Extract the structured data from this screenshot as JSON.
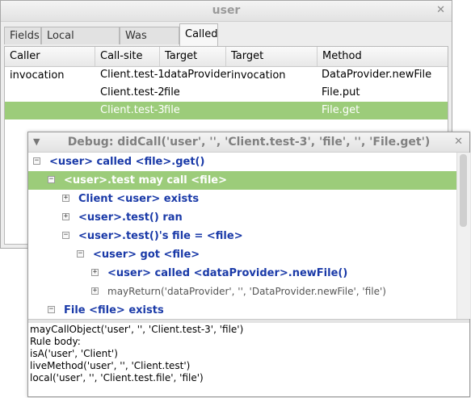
{
  "back_window": {
    "title": "user",
    "close_glyph": "✕",
    "tabs": [
      {
        "label": "Fields",
        "active": false
      },
      {
        "label": "Local variables",
        "active": false
      },
      {
        "label": "Was called",
        "active": false
      },
      {
        "label": "Called",
        "active": true
      }
    ],
    "columns": [
      "Caller invocation",
      "Call-site",
      "Target",
      "Target invocation",
      "Method"
    ],
    "rows": [
      {
        "caller_invocation": "",
        "call_site": "Client.test-1",
        "target": "dataProvider",
        "target_invocation": "",
        "method": "DataProvider.newFile",
        "selected": false
      },
      {
        "caller_invocation": "",
        "call_site": "Client.test-2",
        "target": "file",
        "target_invocation": "",
        "method": "File.put",
        "selected": false
      },
      {
        "caller_invocation": "",
        "call_site": "Client.test-3",
        "target": "file",
        "target_invocation": "",
        "method": "File.get",
        "selected": true
      }
    ],
    "selection_color": "#9ccc7a"
  },
  "debug_window": {
    "title": "Debug: didCall('user', '', 'Client.test-3', 'file', '', 'File.get')",
    "menu_glyph": "▼",
    "close_glyph": "✕",
    "tree": [
      {
        "label": "<user> called <file>.get()",
        "expander": "−",
        "selected": false,
        "plain": false
      },
      {
        "label": "<user>.test may call <file>",
        "expander": "−",
        "selected": true,
        "plain": false
      },
      {
        "label": "Client <user> exists",
        "expander": "+",
        "selected": false,
        "plain": false
      },
      {
        "label": "<user>.test() ran",
        "expander": "+",
        "selected": false,
        "plain": false
      },
      {
        "label": "<user>.test()'s file = <file>",
        "expander": "−",
        "selected": false,
        "plain": false
      },
      {
        "label": "<user> got <file>",
        "expander": "−",
        "selected": false,
        "plain": false
      },
      {
        "label": "<user> called <dataProvider>.newFile()",
        "expander": "+",
        "selected": false,
        "plain": false
      },
      {
        "label": "mayReturn('dataProvider', '', 'DataProvider.newFile', 'file')",
        "expander": "+",
        "selected": false,
        "plain": true
      },
      {
        "label": "File <file> exists",
        "expander": "−",
        "selected": false,
        "plain": false
      }
    ],
    "rule_text": [
      "mayCallObject('user', '', 'Client.test-3', 'file')",
      "Rule body:",
      "isA('user', 'Client')",
      "liveMethod('user', '', 'Client.test')",
      "local('user', '', 'Client.test.file', 'file')"
    ],
    "label_color": "#1a3aa8"
  }
}
